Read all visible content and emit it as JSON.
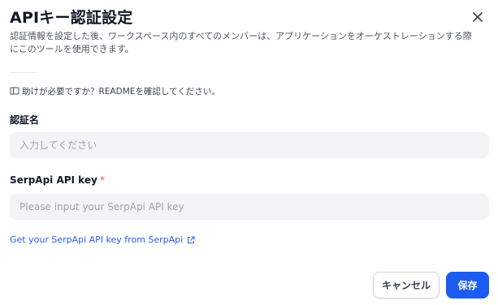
{
  "dialog": {
    "title": "APIキー認証設定",
    "description": "認証情報を設定した後、ワークスペース内のすべてのメンバーは、アプリケーションをオーケストレーションする際にこのツールを使用できます。",
    "help_text": "助けが必要ですか？READMEを確認してください。",
    "close_icon": "close-icon"
  },
  "form": {
    "auth_name": {
      "label": "認証名",
      "placeholder": "入力してください",
      "value": ""
    },
    "api_key": {
      "label": "SerpApi API key",
      "required_marker": "*",
      "placeholder": "Please input your SerpApi API key",
      "value": ""
    },
    "link_text": "Get your SerpApi API key from SerpApi"
  },
  "footer": {
    "cancel_label": "キャンセル",
    "save_label": "保存"
  },
  "colors": {
    "primary": "#1d5cf0",
    "link": "#2563eb",
    "required": "#ef4444",
    "input_bg": "#f3f4f6"
  }
}
